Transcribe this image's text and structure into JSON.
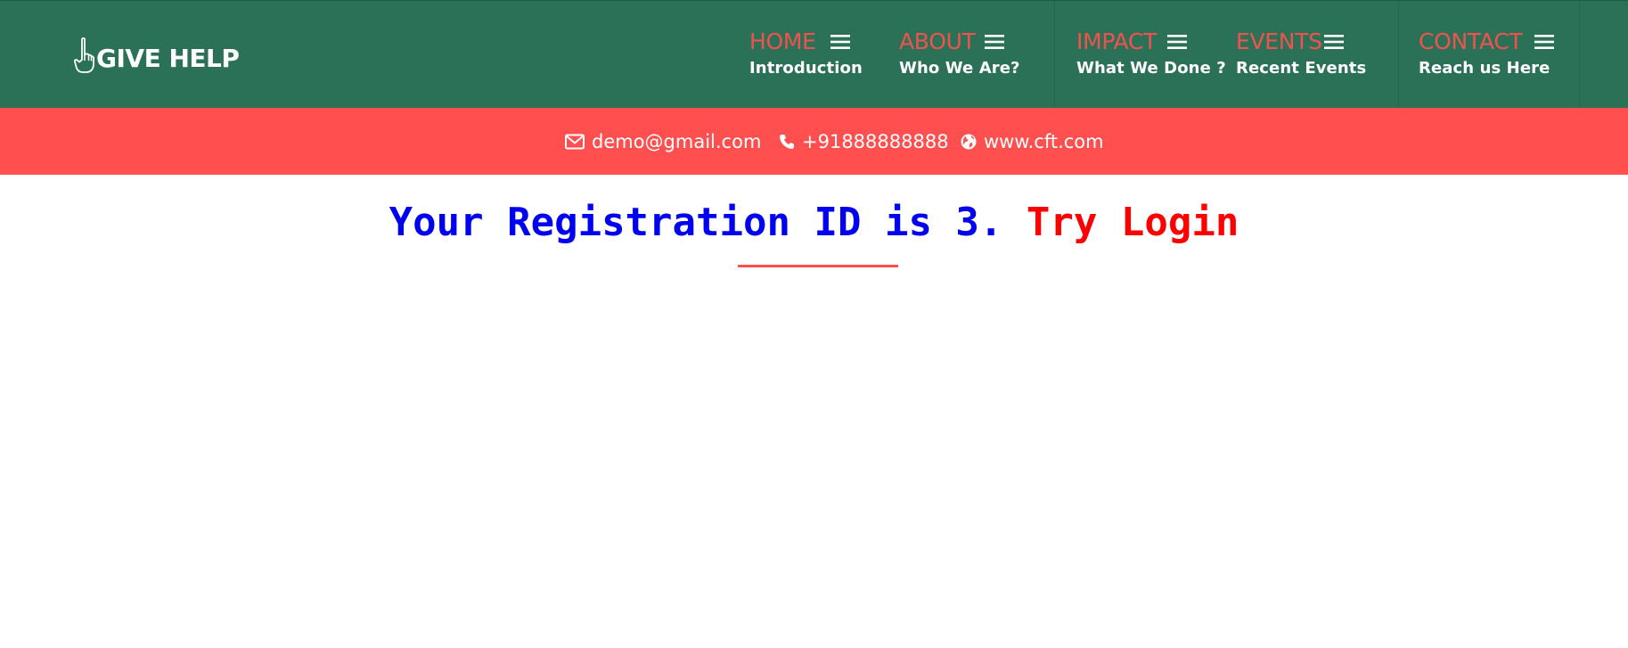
{
  "brand": {
    "name": "GIVE HELP",
    "icon": "pointing-hand-icon"
  },
  "nav": {
    "items": [
      {
        "title": "HOME",
        "subtitle": "Introduction",
        "icon": "menu-icon"
      },
      {
        "title": "ABOUT",
        "subtitle": "Who We Are?",
        "icon": "menu-icon"
      },
      {
        "title": "IMPACT",
        "subtitle": "What We Done ?",
        "icon": "menu-icon"
      },
      {
        "title": "EVENTS",
        "subtitle": "Recent Events",
        "icon": "menu-icon"
      },
      {
        "title": "CONTACT",
        "subtitle": "Reach us Here",
        "icon": "menu-icon"
      }
    ]
  },
  "contact": {
    "email": "demo@gmail.com",
    "phone": "+91888888888",
    "website": "www.cft.com",
    "email_icon": "envelope-icon",
    "phone_icon": "phone-icon",
    "website_icon": "globe-icon"
  },
  "message": {
    "text": "Your Registration ID is 3.",
    "link": "Try Login"
  },
  "colors": {
    "header_bg": "#2b7158",
    "contact_bar_bg": "#ff4f4f",
    "nav_title": "#f0524c",
    "message_text": "#0000f0",
    "message_link": "#ff0000",
    "underline": "#ff4f4f"
  }
}
